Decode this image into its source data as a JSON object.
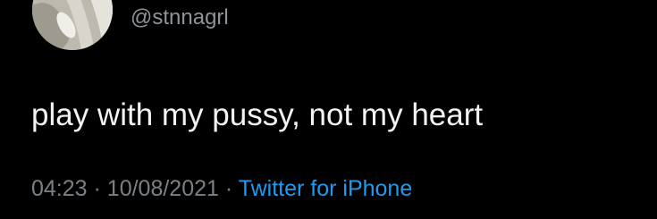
{
  "tweet": {
    "handle": "@stnnagrl",
    "text": "play with my pussy, not my heart",
    "time": "04:23",
    "date": "10/08/2021",
    "source": "Twitter for iPhone",
    "separator": "·"
  },
  "colors": {
    "background": "#000000",
    "text": "#f2f2f2",
    "secondary": "#7b8084",
    "link": "#1d9bf0"
  }
}
